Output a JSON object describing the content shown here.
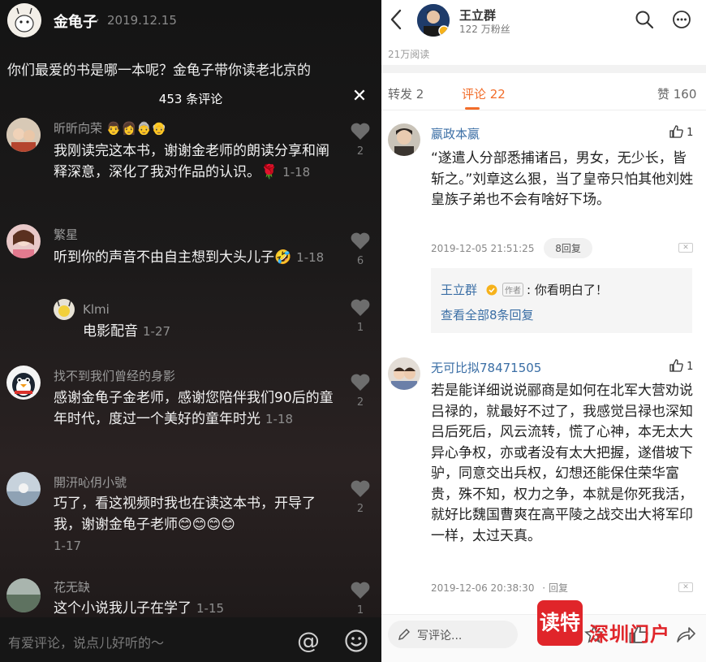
{
  "left": {
    "author": "金龟子",
    "date": "2019.12.15",
    "post_title": "你们最爱的书是哪一本呢？金龟子带你读老北京的",
    "comment_count": "453 条评论",
    "comments": [
      {
        "user": "昕昕向荣",
        "emojis": "👨👩👵👴",
        "text": "我刚读完这本书，谢谢金老师的朗读分享和阐释深意，深化了我对作品的认识。🌹",
        "date": "1-18",
        "likes": "2"
      },
      {
        "user": "繁星",
        "text": "听到你的声音不由自主想到大头儿子🤣",
        "date": "1-18",
        "likes": "6"
      },
      {
        "user": "Klmi",
        "text": "电影配音",
        "date": "1-27",
        "likes": "1"
      },
      {
        "user": "找不到我们曾经的身影",
        "text": "感谢金龟子金老师，感谢您陪伴我们90后的童年时代，度过一个美好的童年时光",
        "date": "1-18",
        "likes": "2"
      },
      {
        "user": "開汧吣仴小號",
        "text": "巧了，看这视频时我也在读这本书，开导了我，谢谢金龟子老师😊😊😊😊",
        "date": "1-17",
        "likes": "2"
      },
      {
        "user": "花无缺",
        "text": "这个小说我儿子在学了",
        "date": "1-15",
        "likes": "1"
      }
    ],
    "input_placeholder": "有爱评论，说点儿好听的～",
    "at_symbol": "@"
  },
  "right": {
    "user": "王立群",
    "fans": "122 万粉丝",
    "reads": "21万阅读",
    "tabs": {
      "repost": "转发 2",
      "comment": "评论 22",
      "like": "赞 160"
    },
    "comments": [
      {
        "user": "嬴政本嬴",
        "likes": "1",
        "text": "“遂遣人分部悉捕诸吕，男女，无少长，皆斩之。”刘章这么狠，当了皇帝只怕其他刘姓皇族子弟也不会有啥好下场。",
        "time": "2019-12-05 21:51:25",
        "reply_label": "8回复",
        "sub_reply": {
          "user": "王立群",
          "tag": "作者",
          "text": ": 你看明白了！",
          "view_all": "查看全部8条回复"
        }
      },
      {
        "user": "无可比拟78471505",
        "likes": "1",
        "text": "若是能详细说说郦商是如何在北军大营劝说吕禄的，就最好不过了，我感觉吕禄也深知吕后死后，风云流转，慌了心神，本无太大异心争权，亦或者没有太大把握，遂借坡下驴，同意交出兵权，幻想还能保住荣华富贵，殊不知，权力之争，本就是你死我活，就好比魏国曹爽在高平陵之战交出大将军印一样，太过天真。",
        "time": "2019-12-06 20:38:30",
        "reply_label": "回复"
      }
    ],
    "write_placeholder": "写评论...",
    "logo_char": "读特",
    "logo_text": "深圳门户"
  },
  "colors": {
    "accent_orange": "#f26d2a",
    "link_blue": "#3a6ea5",
    "brand_red": "#e0252a"
  }
}
